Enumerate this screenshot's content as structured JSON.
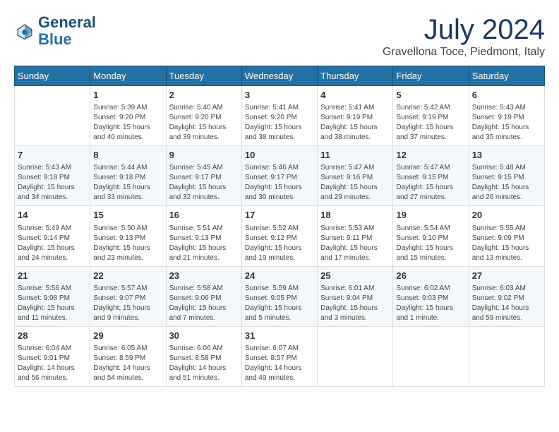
{
  "header": {
    "logo_line1": "General",
    "logo_line2": "Blue",
    "month_title": "July 2024",
    "location": "Gravellona Toce, Piedmont, Italy"
  },
  "weekdays": [
    "Sunday",
    "Monday",
    "Tuesday",
    "Wednesday",
    "Thursday",
    "Friday",
    "Saturday"
  ],
  "weeks": [
    [
      {
        "day": "",
        "info": ""
      },
      {
        "day": "1",
        "info": "Sunrise: 5:39 AM\nSunset: 9:20 PM\nDaylight: 15 hours\nand 40 minutes."
      },
      {
        "day": "2",
        "info": "Sunrise: 5:40 AM\nSunset: 9:20 PM\nDaylight: 15 hours\nand 39 minutes."
      },
      {
        "day": "3",
        "info": "Sunrise: 5:41 AM\nSunset: 9:20 PM\nDaylight: 15 hours\nand 38 minutes."
      },
      {
        "day": "4",
        "info": "Sunrise: 5:41 AM\nSunset: 9:19 PM\nDaylight: 15 hours\nand 38 minutes."
      },
      {
        "day": "5",
        "info": "Sunrise: 5:42 AM\nSunset: 9:19 PM\nDaylight: 15 hours\nand 37 minutes."
      },
      {
        "day": "6",
        "info": "Sunrise: 5:43 AM\nSunset: 9:19 PM\nDaylight: 15 hours\nand 35 minutes."
      }
    ],
    [
      {
        "day": "7",
        "info": "Sunrise: 5:43 AM\nSunset: 9:18 PM\nDaylight: 15 hours\nand 34 minutes."
      },
      {
        "day": "8",
        "info": "Sunrise: 5:44 AM\nSunset: 9:18 PM\nDaylight: 15 hours\nand 33 minutes."
      },
      {
        "day": "9",
        "info": "Sunrise: 5:45 AM\nSunset: 9:17 PM\nDaylight: 15 hours\nand 32 minutes."
      },
      {
        "day": "10",
        "info": "Sunrise: 5:46 AM\nSunset: 9:17 PM\nDaylight: 15 hours\nand 30 minutes."
      },
      {
        "day": "11",
        "info": "Sunrise: 5:47 AM\nSunset: 9:16 PM\nDaylight: 15 hours\nand 29 minutes."
      },
      {
        "day": "12",
        "info": "Sunrise: 5:47 AM\nSunset: 9:15 PM\nDaylight: 15 hours\nand 27 minutes."
      },
      {
        "day": "13",
        "info": "Sunrise: 5:48 AM\nSunset: 9:15 PM\nDaylight: 15 hours\nand 26 minutes."
      }
    ],
    [
      {
        "day": "14",
        "info": "Sunrise: 5:49 AM\nSunset: 9:14 PM\nDaylight: 15 hours\nand 24 minutes."
      },
      {
        "day": "15",
        "info": "Sunrise: 5:50 AM\nSunset: 9:13 PM\nDaylight: 15 hours\nand 23 minutes."
      },
      {
        "day": "16",
        "info": "Sunrise: 5:51 AM\nSunset: 9:13 PM\nDaylight: 15 hours\nand 21 minutes."
      },
      {
        "day": "17",
        "info": "Sunrise: 5:52 AM\nSunset: 9:12 PM\nDaylight: 15 hours\nand 19 minutes."
      },
      {
        "day": "18",
        "info": "Sunrise: 5:53 AM\nSunset: 9:11 PM\nDaylight: 15 hours\nand 17 minutes."
      },
      {
        "day": "19",
        "info": "Sunrise: 5:54 AM\nSunset: 9:10 PM\nDaylight: 15 hours\nand 15 minutes."
      },
      {
        "day": "20",
        "info": "Sunrise: 5:55 AM\nSunset: 9:09 PM\nDaylight: 15 hours\nand 13 minutes."
      }
    ],
    [
      {
        "day": "21",
        "info": "Sunrise: 5:56 AM\nSunset: 9:08 PM\nDaylight: 15 hours\nand 11 minutes."
      },
      {
        "day": "22",
        "info": "Sunrise: 5:57 AM\nSunset: 9:07 PM\nDaylight: 15 hours\nand 9 minutes."
      },
      {
        "day": "23",
        "info": "Sunrise: 5:58 AM\nSunset: 9:06 PM\nDaylight: 15 hours\nand 7 minutes."
      },
      {
        "day": "24",
        "info": "Sunrise: 5:59 AM\nSunset: 9:05 PM\nDaylight: 15 hours\nand 5 minutes."
      },
      {
        "day": "25",
        "info": "Sunrise: 6:01 AM\nSunset: 9:04 PM\nDaylight: 15 hours\nand 3 minutes."
      },
      {
        "day": "26",
        "info": "Sunrise: 6:02 AM\nSunset: 9:03 PM\nDaylight: 15 hours\nand 1 minute."
      },
      {
        "day": "27",
        "info": "Sunrise: 6:03 AM\nSunset: 9:02 PM\nDaylight: 14 hours\nand 59 minutes."
      }
    ],
    [
      {
        "day": "28",
        "info": "Sunrise: 6:04 AM\nSunset: 9:01 PM\nDaylight: 14 hours\nand 56 minutes."
      },
      {
        "day": "29",
        "info": "Sunrise: 6:05 AM\nSunset: 8:59 PM\nDaylight: 14 hours\nand 54 minutes."
      },
      {
        "day": "30",
        "info": "Sunrise: 6:06 AM\nSunset: 8:58 PM\nDaylight: 14 hours\nand 51 minutes."
      },
      {
        "day": "31",
        "info": "Sunrise: 6:07 AM\nSunset: 8:57 PM\nDaylight: 14 hours\nand 49 minutes."
      },
      {
        "day": "",
        "info": ""
      },
      {
        "day": "",
        "info": ""
      },
      {
        "day": "",
        "info": ""
      }
    ]
  ]
}
